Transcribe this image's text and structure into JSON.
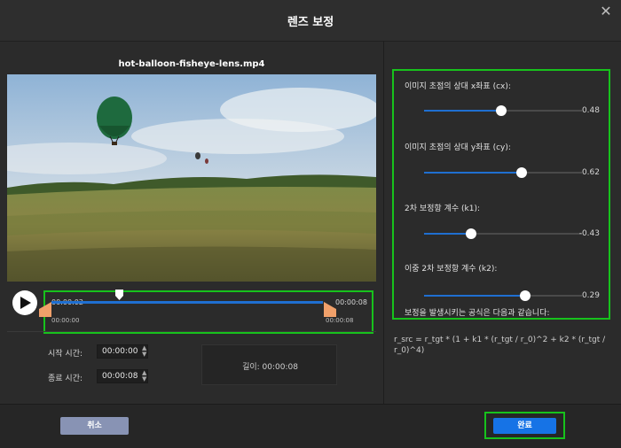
{
  "window": {
    "title": "렌즈 보정",
    "close_glyph": "✕"
  },
  "video": {
    "filename": "hot-balloon-fisheye-lens.mp4"
  },
  "timeline": {
    "current_left": "00:00:02",
    "current_right": "00:00:08",
    "start_small": "00:00:00",
    "end_small": "00:00:08",
    "playhead_fraction": 0.25,
    "accent_color": "#1f6fd1",
    "handle_color": "#f0a06a"
  },
  "trim": {
    "start_label": "시작 시간:",
    "start_value": "00:00:00",
    "end_label": "종료 시간:",
    "end_value": "00:00:08",
    "length_text": "길이: 00:00:08"
  },
  "params": [
    {
      "label": "이미지 초점의 상대 x좌표 (cx):",
      "value": "0.48",
      "fraction": 0.49
    },
    {
      "label": "이미지 초점의 상대 y좌표 (cy):",
      "value": "0.62",
      "fraction": 0.62
    },
    {
      "label": "2차 보정항 계수 (k1):",
      "value": "-0.43",
      "fraction": 0.3
    },
    {
      "label": "이중 2차 보정항 계수 (k2):",
      "value": "0.29",
      "fraction": 0.64
    }
  ],
  "formula": {
    "intro": "보정을 발생시키는 공식은 다음과 같습니다:",
    "text": "r_src = r_tgt * (1 + k1 * (r_tgt / r_0)^2 + k2 * (r_tgt / r_0)^4)"
  },
  "footer": {
    "cancel_label": "취소",
    "done_label": "완료"
  },
  "icons": [
    "close-icon",
    "play-icon",
    "playhead-icon",
    "trim-handle-icon",
    "spinner-icon"
  ]
}
